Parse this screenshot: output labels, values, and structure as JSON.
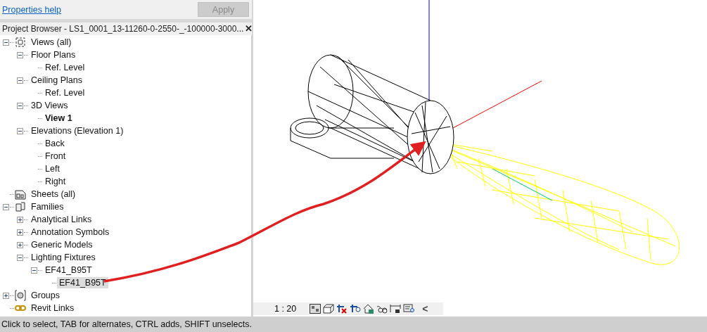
{
  "properties": {
    "help_link": "Properties help",
    "apply_button": {
      "label": "Apply",
      "disabled": true
    }
  },
  "project_browser": {
    "title": "Project Browser - LS1_0001_13-11260-0-2550-_-100000-3000...",
    "close": "✕",
    "tree": [
      {
        "label": "Views (all)",
        "kind": "views",
        "expanded": true,
        "selected": false,
        "current": false,
        "children": [
          {
            "label": "Floor Plans",
            "expanded": true,
            "selected": false,
            "current": false,
            "children": [
              {
                "label": "Ref. Level",
                "selected": false,
                "current": false
              }
            ]
          },
          {
            "label": "Ceiling Plans",
            "expanded": true,
            "selected": false,
            "current": false,
            "children": [
              {
                "label": "Ref. Level",
                "selected": false,
                "current": false
              }
            ]
          },
          {
            "label": "3D Views",
            "expanded": true,
            "selected": false,
            "current": false,
            "children": [
              {
                "label": "View 1",
                "selected": false,
                "current": true
              }
            ]
          },
          {
            "label": "Elevations (Elevation 1)",
            "expanded": true,
            "selected": false,
            "current": false,
            "children": [
              {
                "label": "Back",
                "selected": false,
                "current": false
              },
              {
                "label": "Front",
                "selected": false,
                "current": false
              },
              {
                "label": "Left",
                "selected": false,
                "current": false
              },
              {
                "label": "Right",
                "selected": false,
                "current": false
              }
            ]
          }
        ]
      },
      {
        "label": "Sheets (all)",
        "kind": "sheets",
        "selected": false,
        "current": false
      },
      {
        "label": "Families",
        "kind": "families",
        "expanded": true,
        "selected": false,
        "current": false,
        "children": [
          {
            "label": "Analytical Links",
            "expanded": false,
            "selected": false,
            "current": false
          },
          {
            "label": "Annotation Symbols",
            "expanded": false,
            "selected": false,
            "current": false
          },
          {
            "label": "Generic Models",
            "expanded": false,
            "selected": false,
            "current": false
          },
          {
            "label": "Lighting Fixtures",
            "expanded": true,
            "selected": false,
            "current": false,
            "children": [
              {
                "label": "EF41_B95T",
                "expanded": true,
                "selected": false,
                "current": false,
                "children": [
                  {
                    "label": "EF41_B95T",
                    "selected": true,
                    "current": false
                  }
                ]
              }
            ]
          }
        ]
      },
      {
        "label": "Groups",
        "kind": "groups",
        "expanded": false,
        "selected": false,
        "current": false
      },
      {
        "label": "Revit Links",
        "kind": "links",
        "selected": false,
        "current": false
      }
    ]
  },
  "view_control_bar": {
    "scale": "1 : 20",
    "collapse": "<"
  },
  "status_bar": "Click to select, TAB for alternates, CTRL adds, SHIFT unselects."
}
